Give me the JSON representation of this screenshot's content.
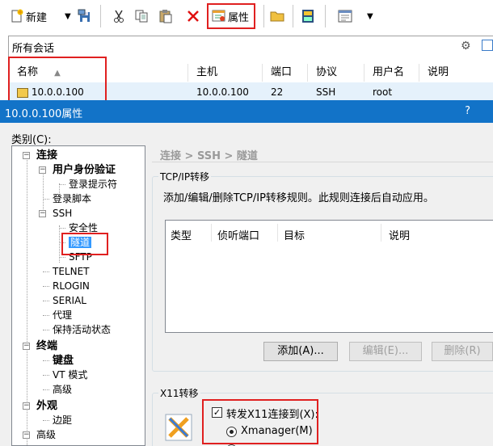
{
  "toolbar": {
    "new_label": "新建",
    "properties_label": "属性",
    "icons": [
      "new-session-icon",
      "dropdown-icon",
      "save-icon",
      "cut-icon",
      "copy-icon",
      "paste-icon",
      "delete-icon",
      "properties-icon",
      "folder-icon",
      "sftp-icon",
      "view-icon",
      "dropdown-icon"
    ]
  },
  "sessions": {
    "title": "所有会话",
    "columns": [
      "名称",
      "主机",
      "端口",
      "协议",
      "用户名",
      "说明"
    ],
    "sort_indicator": "▲",
    "rows": [
      {
        "name": "10.0.0.100",
        "host": "10.0.0.100",
        "port": "22",
        "protocol": "SSH",
        "user": "root",
        "desc": ""
      }
    ]
  },
  "dialog": {
    "title": "10.0.0.100属性",
    "help": "?",
    "category_label": "类别(C):",
    "breadcrumb": "连接 > SSH > 隧道",
    "tree": {
      "connection": "连接",
      "auth": "用户身份验证",
      "login_prompt": "登录提示符",
      "login_script": "登录脚本",
      "ssh": "SSH",
      "security": "安全性",
      "tunnel": "隧道",
      "sftp": "SFTP",
      "telnet": "TELNET",
      "rlogin": "RLOGIN",
      "serial": "SERIAL",
      "proxy": "代理",
      "keepalive": "保持活动状态",
      "terminal": "终端",
      "keyboard": "键盘",
      "vt_mode": "VT 模式",
      "advanced": "高级",
      "appearance": "外观",
      "margins": "边距",
      "advanced2": "高级"
    },
    "tcpip": {
      "group_title": "TCP/IP转移",
      "description": "添加/编辑/删除TCP/IP转移规则。此规则连接后自动应用。",
      "columns": [
        "类型",
        "侦听端口",
        "目标",
        "说明"
      ],
      "add": "添加(A)...",
      "edit": "编辑(E)...",
      "delete": "删除(R)"
    },
    "x11": {
      "group_title": "X11转移",
      "forward_label": "转发X11连接到(X):",
      "forward_checked": true,
      "xmanager_label": "Xmanager(M)",
      "xmanager_selected": true
    }
  },
  "colors": {
    "title_bar": "#1273c8",
    "selection": "#3399ff",
    "highlight_box": "#e02020"
  }
}
